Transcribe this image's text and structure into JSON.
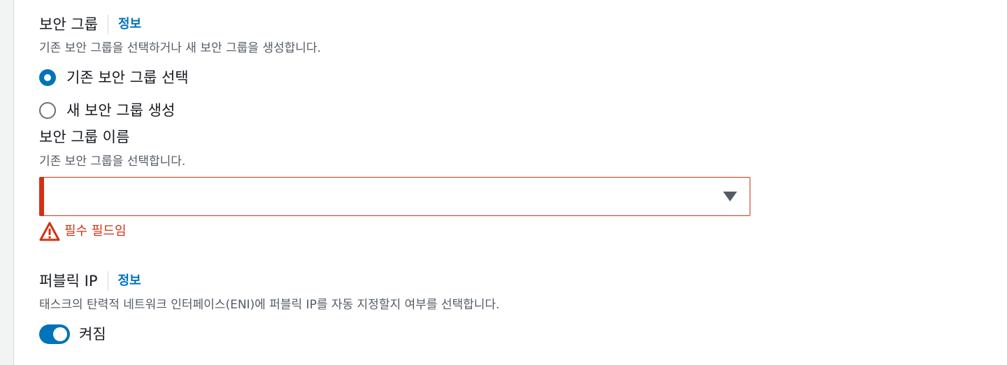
{
  "security_group": {
    "label": "보안 그룹",
    "info_link": "정보",
    "description": "기존 보안 그룹을 선택하거나 새 보안 그룹을 생성합니다.",
    "options": [
      {
        "label": "기존 보안 그룹 선택",
        "selected": true
      },
      {
        "label": "새 보안 그룹 생성",
        "selected": false
      }
    ]
  },
  "security_group_name": {
    "label": "보안 그룹 이름",
    "description": "기존 보안 그룹을 선택합니다.",
    "selected_value": "",
    "error": "필수 필드임"
  },
  "public_ip": {
    "label": "퍼블릭 IP",
    "info_link": "정보",
    "description": "태스크의 탄력적 네트워크 인터페이스(ENI)에 퍼블릭 IP를 자동 지정할지 여부를 선택합니다.",
    "toggle_label": "켜짐",
    "toggle_on": true
  },
  "colors": {
    "accent": "#0073bb",
    "error": "#d13212",
    "text": "#16191f",
    "secondary_text": "#545b64"
  },
  "icons": {
    "error": "warning-triangle-icon",
    "dropdown": "caret-down-icon"
  }
}
